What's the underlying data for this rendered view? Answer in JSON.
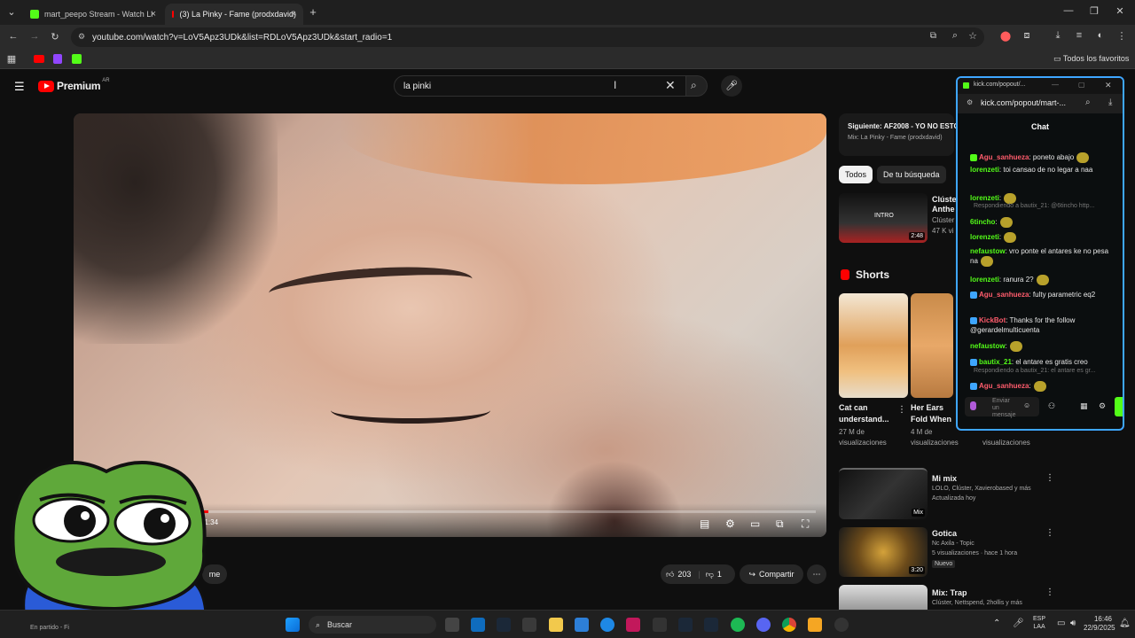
{
  "browser": {
    "tabs": [
      {
        "label": "mart_peepo Stream - Watch Li",
        "active": false
      },
      {
        "label": "(3) La Pinky - Fame (prodxdavid)",
        "active": true
      }
    ],
    "url": "youtube.com/watch?v=LoV5Apz3UDk&list=RDLoV5Apz3UDk&start_radio=1",
    "bookmarks_all": "Todos los favoritos"
  },
  "youtube": {
    "logo": "Premium",
    "region": "AR",
    "search_value": "la pinki",
    "player": {
      "time": "/ 1:34",
      "progress": 0.17
    },
    "actions": {
      "likes": "203",
      "dislikes": "1",
      "share": "Compartir",
      "subscribe_partial": "me"
    },
    "next": {
      "label": "Siguiente: AF2008 - YO NO ESTO",
      "sub": "Mix: La Pinky - Fame (prodxdavid)"
    },
    "chips": [
      "Todos",
      "De tu búsqueda"
    ],
    "rec_top": {
      "title1": "Clúste",
      "title2": "Anthe",
      "line1": "Clúster",
      "line2": "47 K vi",
      "duration": "2:48",
      "thumb_text": "INTRO"
    },
    "shorts": {
      "header": "Shorts",
      "items": [
        {
          "title1": "Cat can",
          "title2": "understand...",
          "views1": "27 M de",
          "views2": "visualizaciones"
        },
        {
          "title1": "Her Ears",
          "title2": "Fold When",
          "views1": "4 M de",
          "views2": "visualizaciones"
        },
        {
          "title1": "",
          "title2": "",
          "views1": "",
          "views2": "visualizaciones"
        }
      ]
    },
    "mixes": [
      {
        "title": "Mi mix",
        "line1": "LOLO, Clúster, Xavierobased y más",
        "line2": "Actualizada hoy",
        "badge": "Mix",
        "duration": ""
      },
      {
        "title": "Gotica",
        "line1": "Nc Axila - Topic",
        "line2": "5 visualizaciones · hace 1 hora",
        "badge": "Nuevo",
        "duration": "3:20"
      },
      {
        "title": "Mix: Trap",
        "line1": "Clúster, Nettspend, 2hollis y más",
        "line2": "",
        "badge": "",
        "duration": ""
      }
    ]
  },
  "kick": {
    "url": "kick.com/popout/mart-...",
    "title_bar": "kick.com/popout/...",
    "chat_title": "Chat",
    "messages": [
      {
        "user": "Agu_sanhueza",
        "color": "#ff5c6c",
        "text": ": poneto abajo"
      },
      {
        "user": "lorenzeti",
        "color": "#53fc18",
        "text": ": toi cansao de no legar a naa"
      },
      {
        "user": "lorenzeti",
        "color": "#53fc18",
        "text": ":"
      },
      {
        "user": "6tincho",
        "color": "#53fc18",
        "text": ":"
      },
      {
        "user": "lorenzeti",
        "color": "#53fc18",
        "text": ":"
      },
      {
        "user": "nefaustow",
        "color": "#53fc18",
        "text": ": vro ponte el antares ke no pesa na"
      },
      {
        "user": "lorenzeti",
        "color": "#53fc18",
        "text": ": ranura 2?"
      },
      {
        "user": "Agu_sanhueza",
        "color": "#ff5c6c",
        "text": ": fulty parametric eq2"
      },
      {
        "user": "KickBot",
        "color": "#ff5c6c",
        "text": ": Thanks for the follow @gerardelmulticuenta"
      },
      {
        "user": "nefaustow",
        "color": "#53fc18",
        "text": ":"
      },
      {
        "user": "bautix_21",
        "color": "#53fc18",
        "text": ": el antare es gratis creo"
      },
      {
        "user": "Agu_sanhueza",
        "color": "#ff5c6c",
        "text": ":"
      }
    ],
    "replies": [
      "Respondiendo a bautix_21: @6tincho http...",
      "Respondiendo a bautix_21: el antare es gr..."
    ],
    "input_placeholder": "Enviar un mensaje"
  },
  "taskbar": {
    "search": "Buscar",
    "lang1": "ESP",
    "lang2": "LAA",
    "time": "16:46",
    "date": "22/9/2025",
    "left_status": "En partido - Fi"
  },
  "colors": {
    "yt_red": "#ff0000",
    "kick_green": "#53fc18",
    "accent_blue": "#3ea6ff"
  }
}
